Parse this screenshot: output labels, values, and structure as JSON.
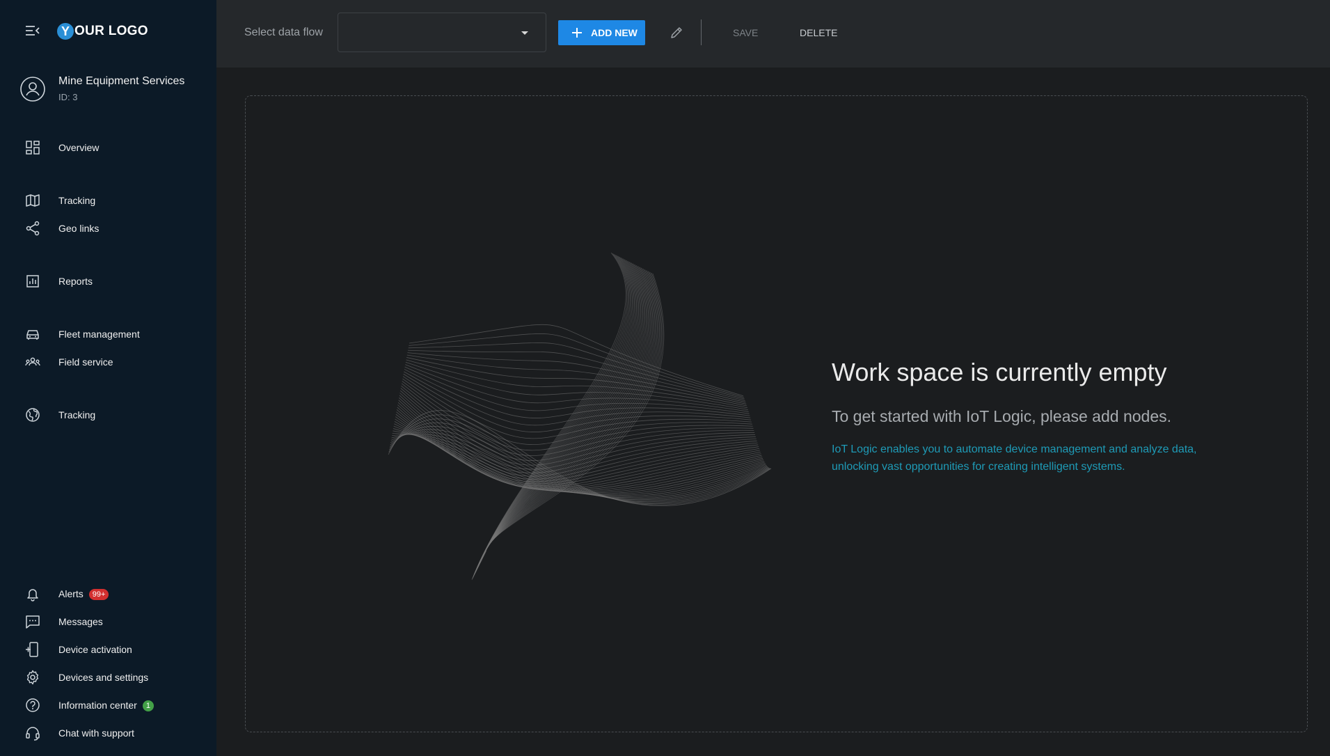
{
  "sidebar": {
    "logo": {
      "mark": "Y",
      "text": "OUR LOGO"
    },
    "account": {
      "name": "Mine Equipment Services",
      "id": "ID: 3"
    },
    "nav": [
      {
        "label": "Overview",
        "icon": "dashboard-icon"
      },
      {
        "label": "Tracking",
        "icon": "map-icon"
      },
      {
        "label": "Geo links",
        "icon": "share-icon"
      },
      {
        "label": "Reports",
        "icon": "bar-chart-icon"
      },
      {
        "label": "Fleet management",
        "icon": "car-icon"
      },
      {
        "label": "Field service",
        "icon": "people-icon"
      },
      {
        "label": "Tracking",
        "icon": "globe-icon"
      }
    ],
    "bottom_nav": [
      {
        "label": "Alerts",
        "icon": "bell-icon",
        "badge": "99+"
      },
      {
        "label": "Messages",
        "icon": "message-icon"
      },
      {
        "label": "Device activation",
        "icon": "device-add-icon"
      },
      {
        "label": "Devices and settings",
        "icon": "gear-icon"
      },
      {
        "label": "Information center",
        "icon": "help-icon",
        "badge": "1"
      },
      {
        "label": "Chat with support",
        "icon": "headset-icon"
      }
    ]
  },
  "toolbar": {
    "select_label": "Select data flow",
    "select_value": "",
    "add_label": "ADD NEW",
    "save_label": "SAVE",
    "delete_label": "DELETE"
  },
  "workspace": {
    "title": "Work space is currently empty",
    "subtitle": "To get started with IoT Logic, please add nodes.",
    "description": "IoT Logic enables you to automate device management and analyze data, unlocking vast opportunities for creating intelligent systems."
  },
  "colors": {
    "sidebar_bg": "#0c1a27",
    "toolbar_bg": "#25282b",
    "content_bg": "#1b1d1f",
    "accent": "#1e88e5",
    "link_text": "#1e9bb7",
    "badge_red": "#d32f2f",
    "badge_green": "#43a047"
  }
}
